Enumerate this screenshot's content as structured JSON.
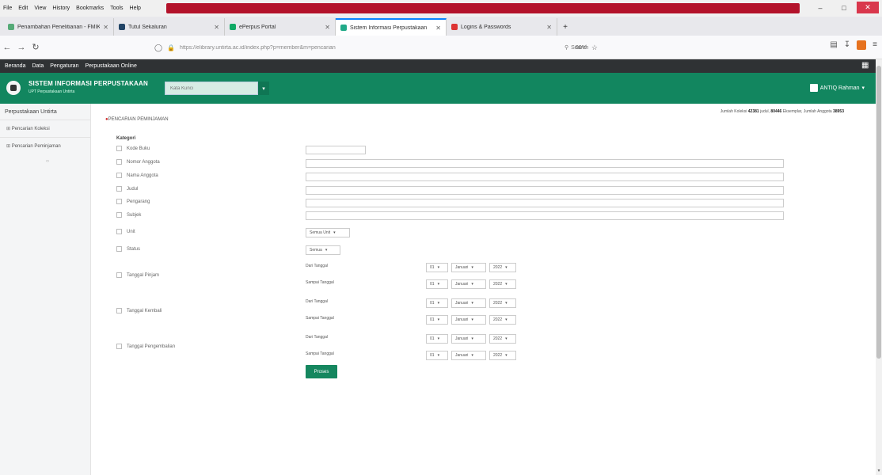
{
  "browser": {
    "menu": [
      "File",
      "Edit",
      "View",
      "History",
      "Bookmarks",
      "Tools",
      "Help"
    ],
    "tabs": [
      {
        "label": "Penambahan Penelitianan - FMIKA - X",
        "active": false
      },
      {
        "label": "Tutul Sekaluran",
        "active": false
      },
      {
        "label": "ePerpus Portal",
        "active": false
      },
      {
        "label": "Sistem Informasi Perpustakaan",
        "active": true
      },
      {
        "label": "Logins & Passwords",
        "active": false
      }
    ],
    "url": "https://elibrary.untirta.ac.id/index.php?p=member&m=pencarian",
    "zoom": "90%",
    "search_placeholder": "Search",
    "bookmarks": [
      "Beranda",
      "Data",
      "Pengaturan",
      "Perpustakaan Online"
    ]
  },
  "header": {
    "title": "SISTEM INFORMASI PERPUSTAKAAN",
    "subtitle": "UPT Perpustakaan Untirta",
    "search_placeholder": "Kata Kunci",
    "user": "ANTIQ Rahman"
  },
  "sidebar": {
    "title": "Perpustakaan Untirta",
    "items": [
      "Pencarian Koleksi",
      "Pencarian Peminjaman"
    ]
  },
  "main": {
    "heading": "PENCARIAN PEMINJAMAN",
    "stats": {
      "jumlah_koleksi_label": "Jumlah Koleksi",
      "jumlah_koleksi": "42381",
      "judul_label": "judul,",
      "eksemplar": "80446",
      "eksemplar_label": "Eksemplar,",
      "anggota_label": "Jumlah Anggota",
      "anggota": "38953"
    },
    "kategori_label": "Kategori",
    "fields": [
      {
        "label": "Kode Buku"
      },
      {
        "label": "Nomor Anggota"
      },
      {
        "label": "Nama Anggota"
      },
      {
        "label": "Judul"
      },
      {
        "label": "Pengarang"
      },
      {
        "label": "Subjek"
      }
    ],
    "unit": {
      "label": "Unit",
      "value": "Semua Unit"
    },
    "status": {
      "label": "Status",
      "value": "Semua"
    },
    "date_groups": [
      {
        "label": "Tanggal Pinjam"
      },
      {
        "label": "Tanggal Kembali"
      },
      {
        "label": "Tanggal Pengembalian"
      }
    ],
    "dari_label": "Dari Tanggal",
    "sampai_label": "Sampai Tanggal",
    "day": "01",
    "month": "Januari",
    "year": "2022",
    "submit": "Proses"
  }
}
